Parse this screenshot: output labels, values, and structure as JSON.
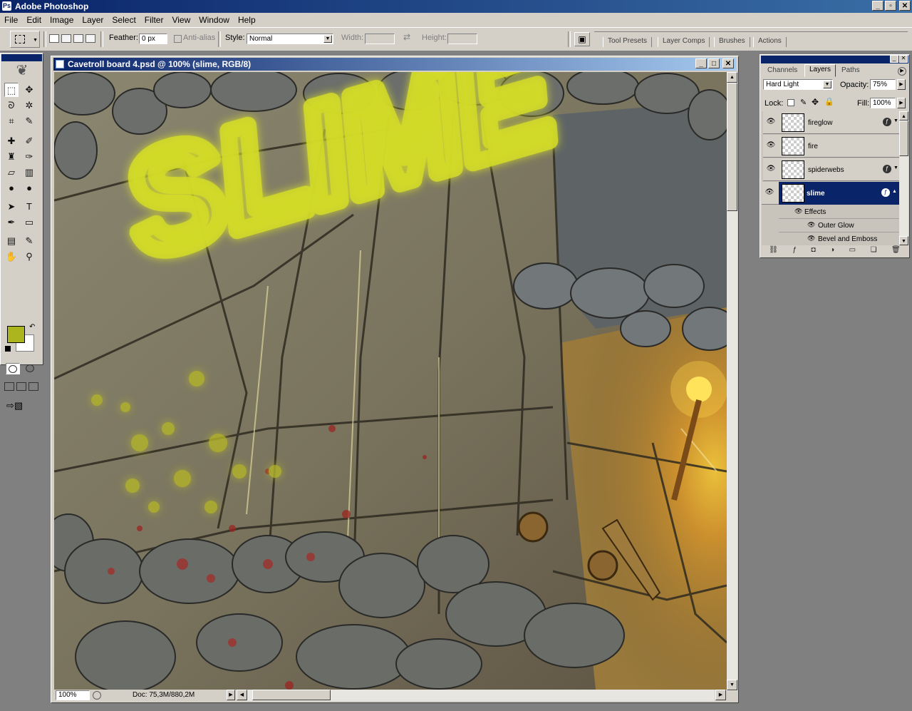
{
  "app": {
    "title": "Adobe Photoshop"
  },
  "window_controls": {
    "minimize": "_",
    "maximize": "▫",
    "close": "✕"
  },
  "menu": [
    "File",
    "Edit",
    "Image",
    "Layer",
    "Select",
    "Filter",
    "View",
    "Window",
    "Help"
  ],
  "options_bar": {
    "feather_label": "Feather:",
    "feather_value": "0 px",
    "antialias_label": "Anti-alias",
    "style_label": "Style:",
    "style_value": "Normal",
    "width_label": "Width:",
    "height_label": "Height:",
    "palette_well_tabs": [
      "Tool Presets",
      "Layer Comps",
      "Brushes",
      "Actions"
    ]
  },
  "toolbox": {
    "foreground_color": "#acb41e",
    "background_color": "#ffffff",
    "tools": [
      {
        "name": "marquee-tool-icon",
        "glyph": "⬚"
      },
      {
        "name": "move-tool-icon",
        "glyph": "✥"
      },
      {
        "name": "lasso-tool-icon",
        "glyph": "ᘐ"
      },
      {
        "name": "magic-wand-tool-icon",
        "glyph": "✲"
      },
      {
        "name": "crop-tool-icon",
        "glyph": "⌗"
      },
      {
        "name": "slice-tool-icon",
        "glyph": "✎"
      },
      {
        "name": "healing-brush-tool-icon",
        "glyph": "✚"
      },
      {
        "name": "brush-tool-icon",
        "glyph": "✐"
      },
      {
        "name": "clone-stamp-tool-icon",
        "glyph": "♜"
      },
      {
        "name": "history-brush-tool-icon",
        "glyph": "✑"
      },
      {
        "name": "eraser-tool-icon",
        "glyph": "▱"
      },
      {
        "name": "gradient-tool-icon",
        "glyph": "▥"
      },
      {
        "name": "blur-tool-icon",
        "glyph": "●"
      },
      {
        "name": "dodge-tool-icon",
        "glyph": "●"
      },
      {
        "name": "path-selection-tool-icon",
        "glyph": "➤"
      },
      {
        "name": "type-tool-icon",
        "glyph": "T"
      },
      {
        "name": "pen-tool-icon",
        "glyph": "✒"
      },
      {
        "name": "shape-tool-icon",
        "glyph": "▭"
      },
      {
        "name": "notes-tool-icon",
        "glyph": "▤"
      },
      {
        "name": "eyedropper-tool-icon",
        "glyph": "✎"
      },
      {
        "name": "hand-tool-icon",
        "glyph": "✋"
      },
      {
        "name": "zoom-tool-icon",
        "glyph": "⚲"
      }
    ]
  },
  "document": {
    "title": "Cavetroll board 4.psd @ 100% (slime, RGB/8)",
    "zoom": "100%",
    "doc_size": "Doc: 75,3M/880,2M",
    "canvas_text": "SLIME"
  },
  "layers_panel": {
    "tabs": [
      "Channels",
      "Layers",
      "Paths"
    ],
    "blend_mode": "Hard Light",
    "opacity_label": "Opacity:",
    "opacity": "75%",
    "lock_label": "Lock:",
    "fill_label": "Fill:",
    "fill": "100%",
    "layers": [
      {
        "name": "fireglow",
        "has_fx": true,
        "selected": false
      },
      {
        "name": "fire",
        "has_fx": false,
        "selected": false
      },
      {
        "name": "spiderwebs",
        "has_fx": true,
        "selected": false
      },
      {
        "name": "slime",
        "has_fx": true,
        "selected": true
      }
    ],
    "effects_label": "Effects",
    "effects": [
      "Outer Glow",
      "Bevel and Emboss"
    ]
  }
}
